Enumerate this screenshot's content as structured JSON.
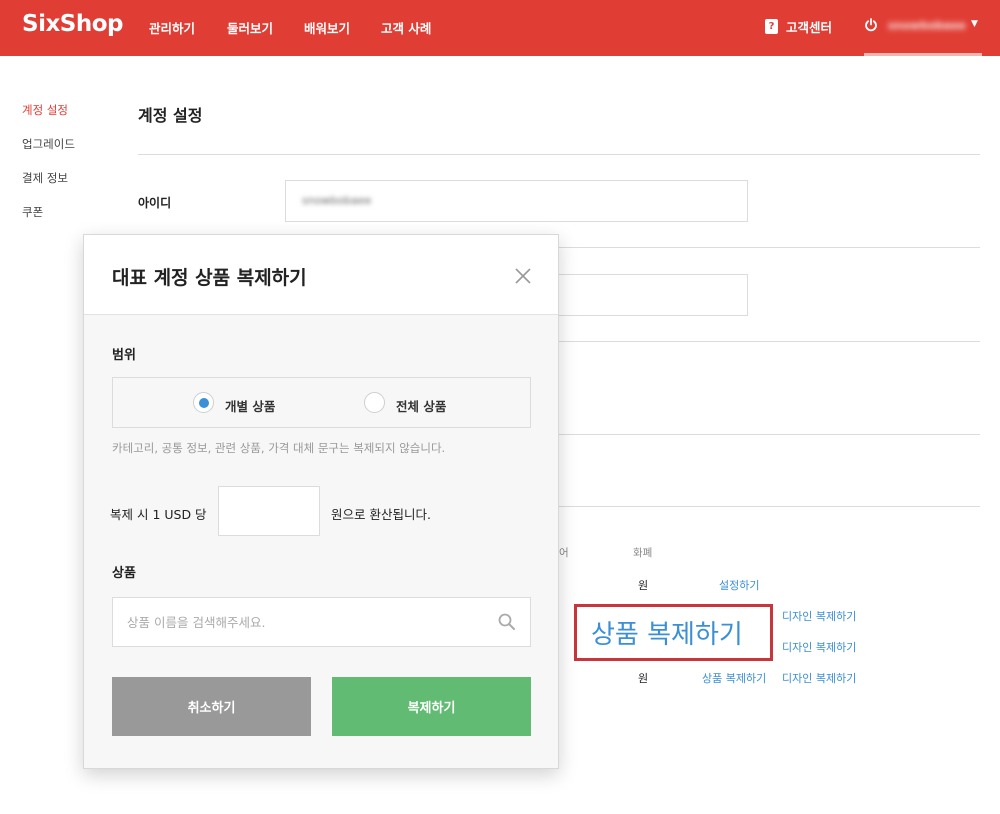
{
  "header": {
    "logo": "SixShop",
    "nav": [
      "관리하기",
      "둘러보기",
      "배워보기",
      "고객 사례"
    ],
    "help_label": "고객센터",
    "username": "snowbobaee"
  },
  "sidebar": {
    "items": [
      {
        "label": "계정 설정",
        "active": true
      },
      {
        "label": "업그레이드",
        "active": false
      },
      {
        "label": "결제 정보",
        "active": false
      },
      {
        "label": "쿠폰",
        "active": false
      }
    ]
  },
  "page": {
    "title": "계정 설정",
    "id_label": "아이디",
    "id_value": "snowbobaee",
    "table_headers": [
      "어",
      "화폐"
    ],
    "rows": [
      {
        "currency": "원",
        "action": "설정하기"
      },
      {
        "action": "디자인 복제하기"
      },
      {
        "action": "디자인 복제하기"
      },
      {
        "currency": "원",
        "product_action": "상품 복제하기",
        "action": "디자인 복제하기"
      }
    ],
    "callout": "상품 복제하기"
  },
  "modal": {
    "title": "대표 계정 상품 복제하기",
    "scope_label": "범위",
    "scope_options": [
      "개별 상품",
      "전체 상품"
    ],
    "note": "카테고리, 공통 정보, 관련 상품, 가격 대체 문구는 복제되지 않습니다.",
    "rate_prefix": "복제 시 1 USD 당",
    "rate_value": "",
    "rate_suffix": "원으로 환산됩니다.",
    "product_label": "상품",
    "search_placeholder": "상품 이름을 검색해주세요.",
    "cancel_label": "취소하기",
    "copy_label": "복제하기"
  },
  "colors": {
    "brand": "#e03e35",
    "link": "#3b8fd6",
    "confirm": "#62bb73",
    "cancel": "#999999"
  }
}
